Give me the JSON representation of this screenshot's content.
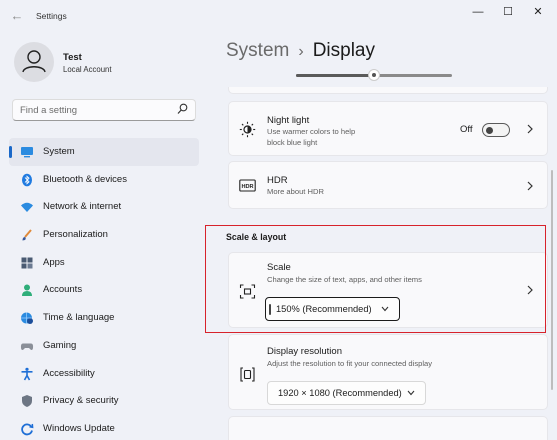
{
  "window": {
    "title": "Settings"
  },
  "user": {
    "name": "Test",
    "account_type": "Local Account"
  },
  "search": {
    "placeholder": "Find a setting"
  },
  "sidebar": {
    "items": [
      {
        "label": "System",
        "icon": "monitor-icon",
        "active": true
      },
      {
        "label": "Bluetooth & devices",
        "icon": "bluetooth-icon"
      },
      {
        "label": "Network & internet",
        "icon": "wifi-icon"
      },
      {
        "label": "Personalization",
        "icon": "brush-icon"
      },
      {
        "label": "Apps",
        "icon": "apps-icon"
      },
      {
        "label": "Accounts",
        "icon": "person-icon"
      },
      {
        "label": "Time & language",
        "icon": "globe-clock-icon"
      },
      {
        "label": "Gaming",
        "icon": "gamepad-icon"
      },
      {
        "label": "Accessibility",
        "icon": "accessibility-icon"
      },
      {
        "label": "Privacy & security",
        "icon": "shield-icon"
      },
      {
        "label": "Windows Update",
        "icon": "update-icon"
      }
    ]
  },
  "header": {
    "parent": "System",
    "separator": "›",
    "current": "Display"
  },
  "brightness": {
    "value": 0.5
  },
  "night_light": {
    "title": "Night light",
    "description_line1": "Use warmer colors to help",
    "description_line2": "block blue light",
    "state_label": "Off"
  },
  "hdr": {
    "title": "HDR",
    "description": "More about HDR"
  },
  "scale_layout": {
    "heading": "Scale & layout"
  },
  "scale": {
    "title": "Scale",
    "description": "Change the size of text, apps, and other items",
    "selected": "150% (Recommended)"
  },
  "resolution": {
    "title": "Display resolution",
    "description": "Adjust the resolution to fit your connected display",
    "selected": "1920 × 1080 (Recommended)"
  },
  "colors": {
    "accent": "#1a68c8",
    "highlight_box": "#d7222b"
  }
}
